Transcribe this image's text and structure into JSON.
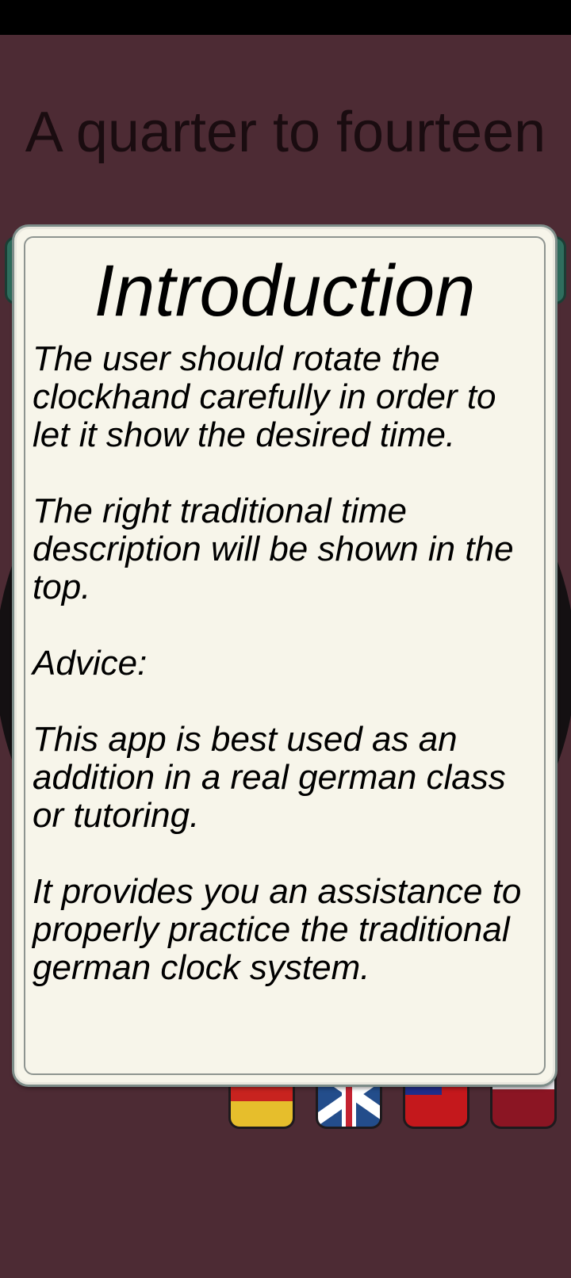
{
  "header": {
    "time_description": "A quarter to fourteen"
  },
  "dialog": {
    "title": "Introduction",
    "paragraphs": [
      "The user should rotate the clockhand carefully in order to let it show the desired time.",
      "The right traditional time description will be shown in the top.",
      "Advice:",
      "This app is best used as an addition in a real german class or tutoring.",
      "It provides you an assistance to properly practice the traditional german clock system."
    ]
  },
  "languages": [
    "german-flag",
    "uk-flag",
    "taiwan-flag",
    "poland-flag"
  ],
  "colors": {
    "background": "#4d2b34",
    "dialog_background": "#f7f5ea",
    "accent_teal": "#2f6e5e"
  }
}
